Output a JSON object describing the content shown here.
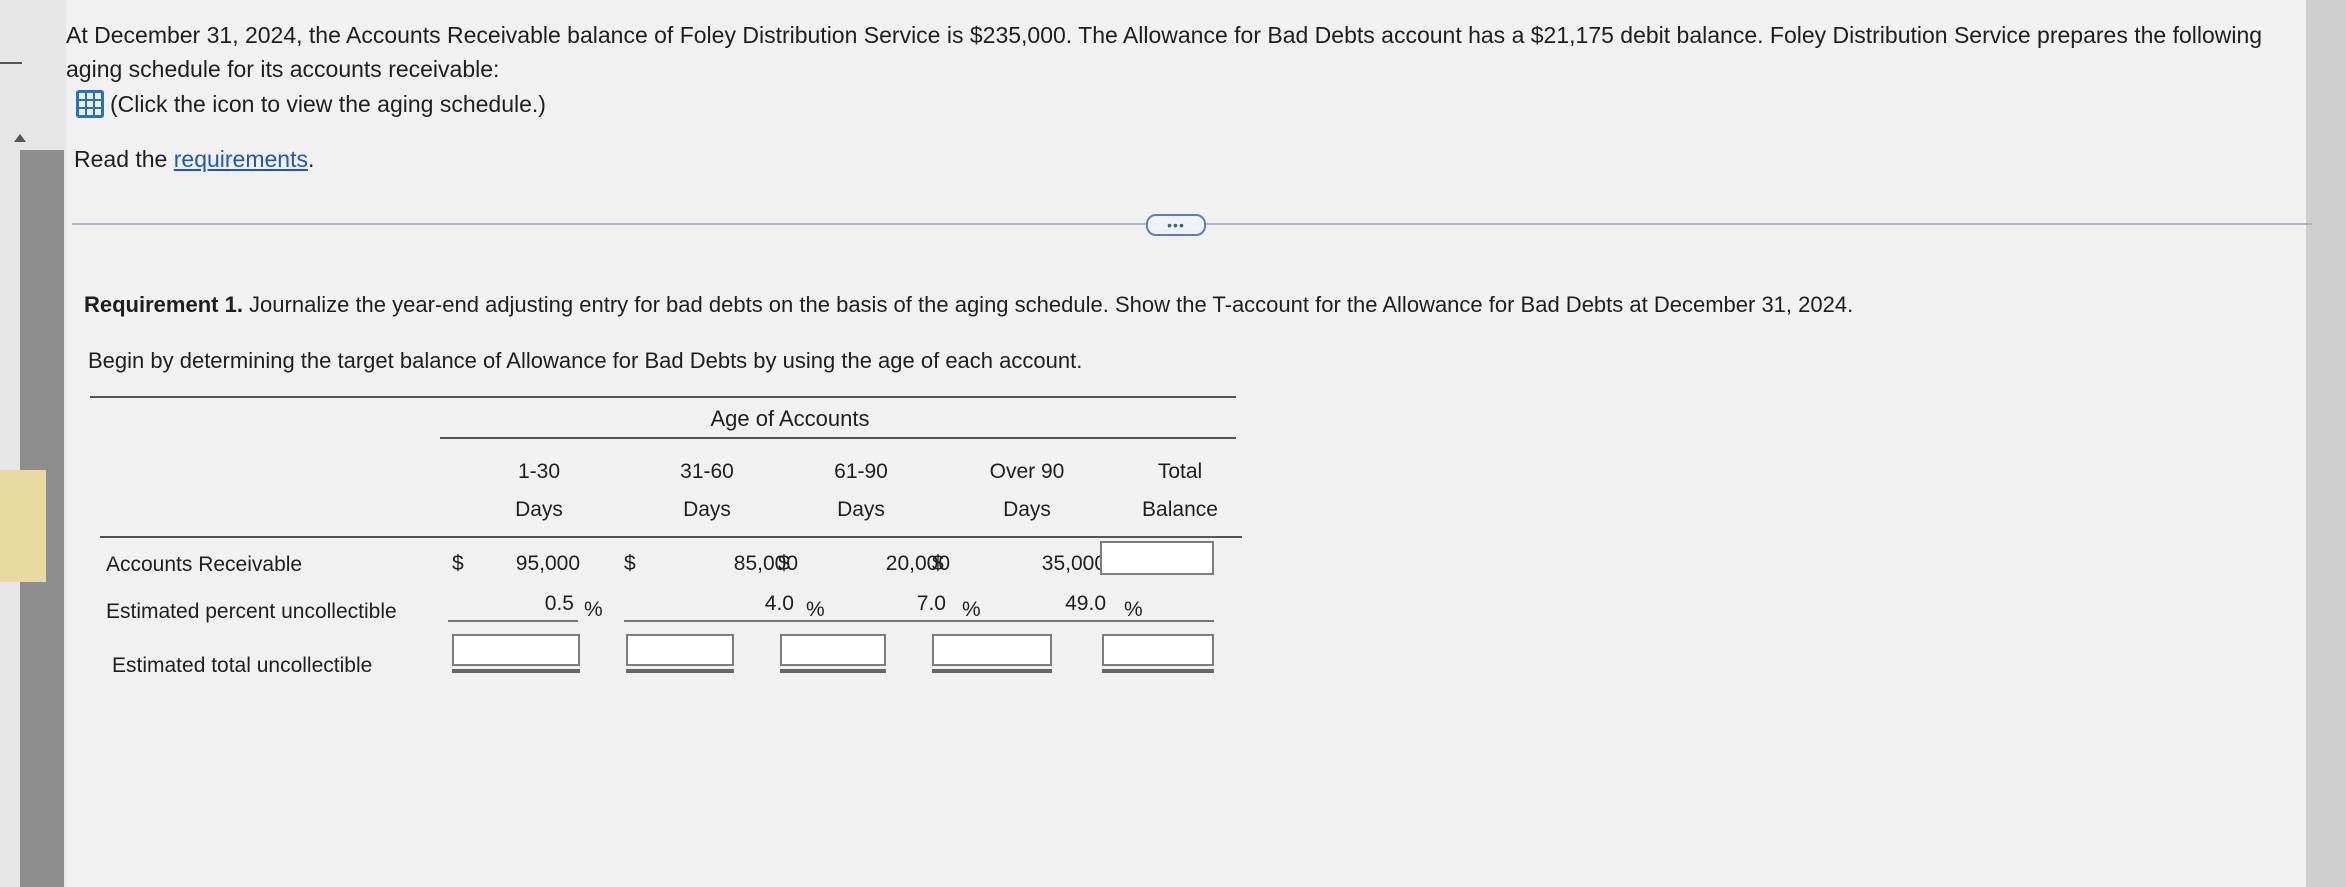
{
  "intro": {
    "text": "At December 31, 2024, the Accounts Receivable balance of Foley Distribution Service is $235,000. The Allowance for Bad Debts account has a $21,175 debit balance. Foley Distribution Service prepares the following aging schedule for its accounts receivable:",
    "icon_link": "(Click the icon to view the aging schedule.)",
    "read_prefix": "Read the",
    "read_link": "requirements",
    "read_suffix": "."
  },
  "more_button": "•••",
  "requirement": {
    "bold": "Requirement 1.",
    "text": " Journalize the year-end adjusting entry for bad debts on the basis of the aging schedule. Show the T-account for the Allowance for Bad Debts at December 31, 2024.",
    "begin": "Begin by determining the target balance of Allowance for Bad Debts by using the age of each account."
  },
  "table": {
    "group_header": "Age of Accounts",
    "columns": [
      {
        "line1": "1-30",
        "line2": "Days"
      },
      {
        "line1": "31-60",
        "line2": "Days"
      },
      {
        "line1": "61-90",
        "line2": "Days"
      },
      {
        "line1": "Over 90",
        "line2": "Days"
      },
      {
        "line1": "Total",
        "line2": "Balance"
      }
    ],
    "rows": {
      "ar_label": "Accounts Receivable",
      "pct_label": "Estimated percent uncollectible",
      "total_label": "Estimated total uncollectible"
    },
    "ar_values": [
      {
        "sign": "$",
        "value": "95,000"
      },
      {
        "sign": "$",
        "value": "85,000"
      },
      {
        "sign": "$",
        "value": "20,000"
      },
      {
        "sign": "$",
        "value": "35,000"
      }
    ],
    "percents": [
      "0.5",
      "4.0",
      "7.0",
      "49.0"
    ],
    "pct_sign": "%"
  },
  "colors": {
    "link": "#1f56b8",
    "icon": "#2a6fc0"
  },
  "icons": [
    "table-grid-icon",
    "more-options-icon",
    "scroll-up-arrow-icon"
  ]
}
